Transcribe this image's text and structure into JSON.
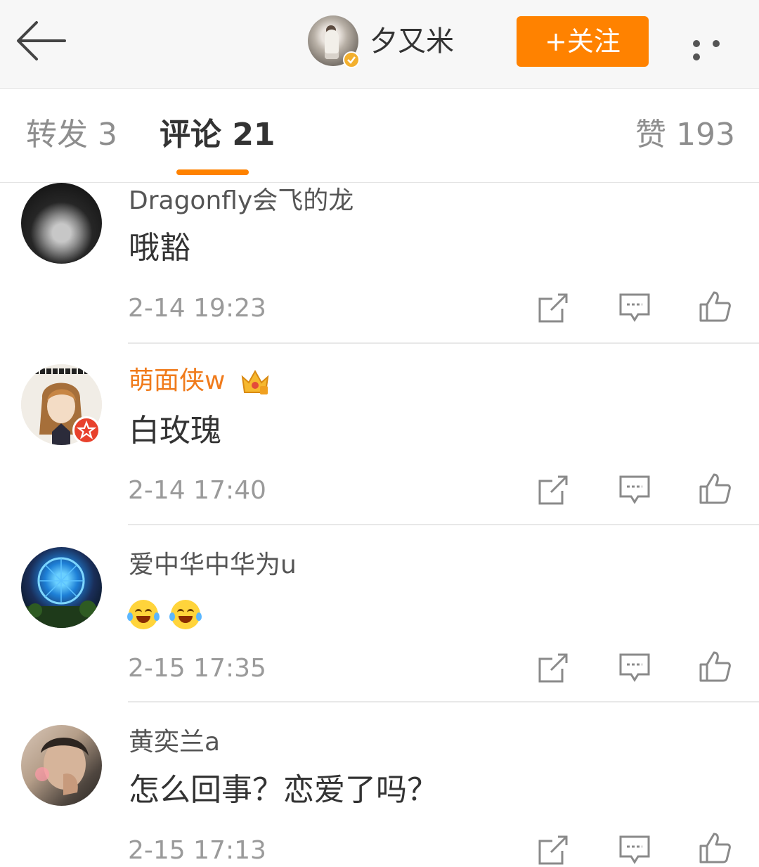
{
  "header": {
    "username": "夕又米",
    "follow_label": "+关注"
  },
  "tabs": {
    "repost": "转发 3",
    "comment": "评论 21",
    "likes": "赞 193"
  },
  "comments": [
    {
      "name": "Dragonfly会飞的龙",
      "text": "哦豁",
      "time": "2-14 19:23"
    },
    {
      "name": "萌面侠w",
      "text": "白玫瑰",
      "time": "2-14 17:40"
    },
    {
      "name": "爱中华中华为u",
      "text": "",
      "time": "2-15 17:35"
    },
    {
      "name": "黄奕兰a",
      "text": "怎么回事？恋爱了吗？",
      "time": "2-15 17:13"
    }
  ],
  "colors": {
    "accent": "#ff8200",
    "vip_name": "#f07b1c"
  },
  "icons": [
    "back-arrow-icon",
    "verified-badge-icon",
    "more-icon",
    "share-icon",
    "reply-icon",
    "like-icon",
    "vip-crown-icon",
    "laugh-cry-emoji-icon"
  ]
}
